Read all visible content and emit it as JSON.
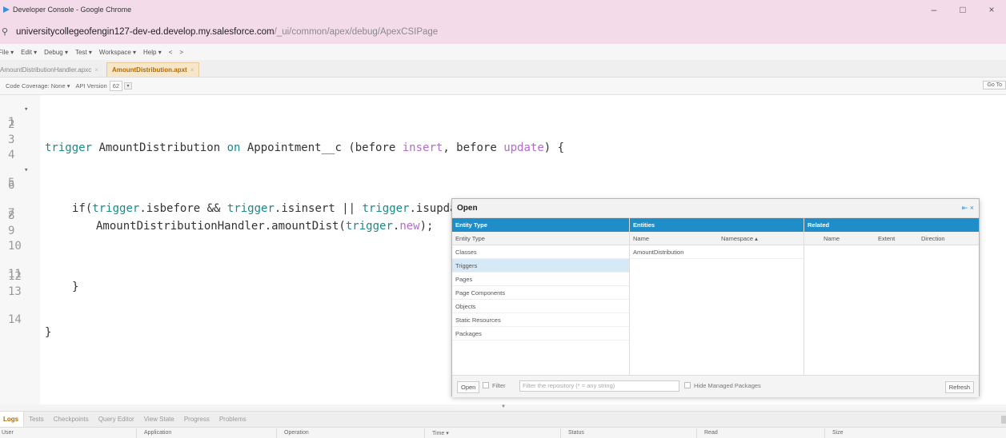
{
  "window": {
    "title": "Developer Console - Google Chrome",
    "controls": [
      "–",
      "□",
      "×"
    ]
  },
  "url": {
    "host": "universitycollegeofengin127-dev-ed.develop.my.salesforce.com",
    "path": "/_ui/common/apex/debug/ApexCSIPage"
  },
  "menu": {
    "items": [
      "File ▾",
      "Edit ▾",
      "Debug ▾",
      "Test ▾",
      "Workspace ▾",
      "Help ▾",
      "<",
      ">"
    ]
  },
  "tabs": [
    {
      "label": "AmountDistributionHandler.apxc",
      "active": false
    },
    {
      "label": "AmountDistribution.apxt",
      "active": true
    }
  ],
  "options": {
    "code_coverage_label": "Code Coverage: None",
    "api_version_label": "API Version",
    "api_version_value": "62",
    "goto_label": "Go To"
  },
  "editor": {
    "lines": [
      {
        "n": "1",
        "fold": true
      },
      {
        "n": "2"
      },
      {
        "n": "3"
      },
      {
        "n": "4"
      },
      {
        "n": "5",
        "fold": true
      },
      {
        "n": "6"
      },
      {
        "n": "7"
      },
      {
        "n": "8"
      },
      {
        "n": "9"
      },
      {
        "n": "10"
      },
      {
        "n": "11"
      },
      {
        "n": "12"
      },
      {
        "n": "13"
      },
      {
        "n": "14"
      }
    ],
    "code": {
      "l1_a": "trigger",
      "l1_b": " AmountDistribution ",
      "l1_c": "on",
      "l1_d": " Appointment__c (before ",
      "l1_e": "insert",
      "l1_f": ", before ",
      "l1_g": "update",
      "l1_h": ") {",
      "l5_a": "if(",
      "l5_b": "trigger",
      "l5_c": ".isbefore && ",
      "l5_d": "trigger",
      "l5_e": ".isinsert || ",
      "l5_f": "trigger",
      "l5_g": ".isupdate){",
      "l7_a": "AmountDistributionHandler.amountDist(",
      "l7_b": "trigger",
      "l7_c": ".",
      "l7_d": "new",
      "l7_e": ");",
      "l11": "}",
      "l14": "}"
    }
  },
  "dialog": {
    "title": "Open",
    "tools": "⇤ ×",
    "entity_panel": {
      "header": "Entity Type",
      "column": "Entity Type",
      "items": [
        "Classes",
        "Triggers",
        "Pages",
        "Page Components",
        "Objects",
        "Static Resources",
        "Packages"
      ],
      "selected_index": 1
    },
    "entities_panel": {
      "header": "Entities",
      "col_name": "Name",
      "col_namespace": "Namespace ▴",
      "items": [
        "AmountDistribution"
      ]
    },
    "related_panel": {
      "header": "Related",
      "col_name": "Name",
      "col_extent": "Extent",
      "col_direction": "Direction"
    },
    "footer": {
      "open_button": "Open",
      "filter_label": "Filter",
      "filter_placeholder": "Filter the repository (* = any string)",
      "hide_managed_label": "Hide Managed Packages",
      "refresh_button": "Refresh"
    }
  },
  "bottom": {
    "tabs": [
      "Logs",
      "Tests",
      "Checkpoints",
      "Query Editor",
      "View State",
      "Progress",
      "Problems"
    ],
    "active_tab": 0,
    "log_columns": [
      "User",
      "Application",
      "Operation",
      "Time ▾",
      "Status",
      "Read",
      "Size"
    ]
  }
}
